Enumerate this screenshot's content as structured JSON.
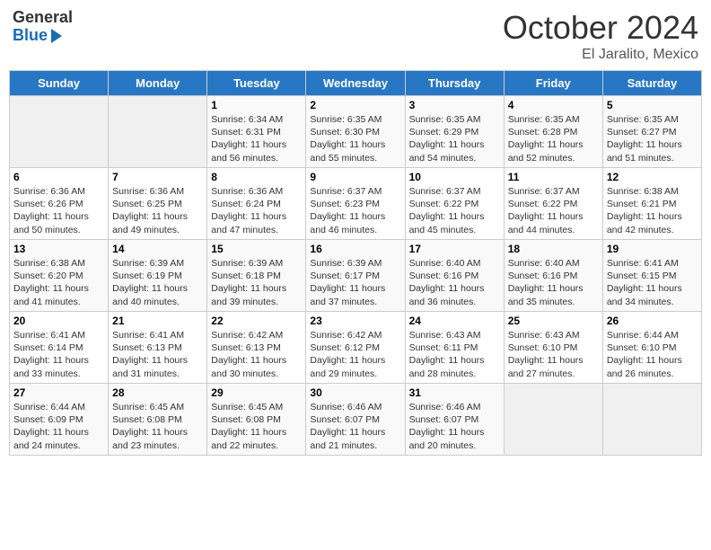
{
  "logo": {
    "general": "General",
    "blue": "Blue"
  },
  "header": {
    "month": "October 2024",
    "location": "El Jaralito, Mexico"
  },
  "days_of_week": [
    "Sunday",
    "Monday",
    "Tuesday",
    "Wednesday",
    "Thursday",
    "Friday",
    "Saturday"
  ],
  "weeks": [
    [
      {
        "day": null
      },
      {
        "day": null
      },
      {
        "day": "1",
        "sunrise": "Sunrise: 6:34 AM",
        "sunset": "Sunset: 6:31 PM",
        "daylight": "Daylight: 11 hours and 56 minutes."
      },
      {
        "day": "2",
        "sunrise": "Sunrise: 6:35 AM",
        "sunset": "Sunset: 6:30 PM",
        "daylight": "Daylight: 11 hours and 55 minutes."
      },
      {
        "day": "3",
        "sunrise": "Sunrise: 6:35 AM",
        "sunset": "Sunset: 6:29 PM",
        "daylight": "Daylight: 11 hours and 54 minutes."
      },
      {
        "day": "4",
        "sunrise": "Sunrise: 6:35 AM",
        "sunset": "Sunset: 6:28 PM",
        "daylight": "Daylight: 11 hours and 52 minutes."
      },
      {
        "day": "5",
        "sunrise": "Sunrise: 6:35 AM",
        "sunset": "Sunset: 6:27 PM",
        "daylight": "Daylight: 11 hours and 51 minutes."
      }
    ],
    [
      {
        "day": "6",
        "sunrise": "Sunrise: 6:36 AM",
        "sunset": "Sunset: 6:26 PM",
        "daylight": "Daylight: 11 hours and 50 minutes."
      },
      {
        "day": "7",
        "sunrise": "Sunrise: 6:36 AM",
        "sunset": "Sunset: 6:25 PM",
        "daylight": "Daylight: 11 hours and 49 minutes."
      },
      {
        "day": "8",
        "sunrise": "Sunrise: 6:36 AM",
        "sunset": "Sunset: 6:24 PM",
        "daylight": "Daylight: 11 hours and 47 minutes."
      },
      {
        "day": "9",
        "sunrise": "Sunrise: 6:37 AM",
        "sunset": "Sunset: 6:23 PM",
        "daylight": "Daylight: 11 hours and 46 minutes."
      },
      {
        "day": "10",
        "sunrise": "Sunrise: 6:37 AM",
        "sunset": "Sunset: 6:22 PM",
        "daylight": "Daylight: 11 hours and 45 minutes."
      },
      {
        "day": "11",
        "sunrise": "Sunrise: 6:37 AM",
        "sunset": "Sunset: 6:22 PM",
        "daylight": "Daylight: 11 hours and 44 minutes."
      },
      {
        "day": "12",
        "sunrise": "Sunrise: 6:38 AM",
        "sunset": "Sunset: 6:21 PM",
        "daylight": "Daylight: 11 hours and 42 minutes."
      }
    ],
    [
      {
        "day": "13",
        "sunrise": "Sunrise: 6:38 AM",
        "sunset": "Sunset: 6:20 PM",
        "daylight": "Daylight: 11 hours and 41 minutes."
      },
      {
        "day": "14",
        "sunrise": "Sunrise: 6:39 AM",
        "sunset": "Sunset: 6:19 PM",
        "daylight": "Daylight: 11 hours and 40 minutes."
      },
      {
        "day": "15",
        "sunrise": "Sunrise: 6:39 AM",
        "sunset": "Sunset: 6:18 PM",
        "daylight": "Daylight: 11 hours and 39 minutes."
      },
      {
        "day": "16",
        "sunrise": "Sunrise: 6:39 AM",
        "sunset": "Sunset: 6:17 PM",
        "daylight": "Daylight: 11 hours and 37 minutes."
      },
      {
        "day": "17",
        "sunrise": "Sunrise: 6:40 AM",
        "sunset": "Sunset: 6:16 PM",
        "daylight": "Daylight: 11 hours and 36 minutes."
      },
      {
        "day": "18",
        "sunrise": "Sunrise: 6:40 AM",
        "sunset": "Sunset: 6:16 PM",
        "daylight": "Daylight: 11 hours and 35 minutes."
      },
      {
        "day": "19",
        "sunrise": "Sunrise: 6:41 AM",
        "sunset": "Sunset: 6:15 PM",
        "daylight": "Daylight: 11 hours and 34 minutes."
      }
    ],
    [
      {
        "day": "20",
        "sunrise": "Sunrise: 6:41 AM",
        "sunset": "Sunset: 6:14 PM",
        "daylight": "Daylight: 11 hours and 33 minutes."
      },
      {
        "day": "21",
        "sunrise": "Sunrise: 6:41 AM",
        "sunset": "Sunset: 6:13 PM",
        "daylight": "Daylight: 11 hours and 31 minutes."
      },
      {
        "day": "22",
        "sunrise": "Sunrise: 6:42 AM",
        "sunset": "Sunset: 6:13 PM",
        "daylight": "Daylight: 11 hours and 30 minutes."
      },
      {
        "day": "23",
        "sunrise": "Sunrise: 6:42 AM",
        "sunset": "Sunset: 6:12 PM",
        "daylight": "Daylight: 11 hours and 29 minutes."
      },
      {
        "day": "24",
        "sunrise": "Sunrise: 6:43 AM",
        "sunset": "Sunset: 6:11 PM",
        "daylight": "Daylight: 11 hours and 28 minutes."
      },
      {
        "day": "25",
        "sunrise": "Sunrise: 6:43 AM",
        "sunset": "Sunset: 6:10 PM",
        "daylight": "Daylight: 11 hours and 27 minutes."
      },
      {
        "day": "26",
        "sunrise": "Sunrise: 6:44 AM",
        "sunset": "Sunset: 6:10 PM",
        "daylight": "Daylight: 11 hours and 26 minutes."
      }
    ],
    [
      {
        "day": "27",
        "sunrise": "Sunrise: 6:44 AM",
        "sunset": "Sunset: 6:09 PM",
        "daylight": "Daylight: 11 hours and 24 minutes."
      },
      {
        "day": "28",
        "sunrise": "Sunrise: 6:45 AM",
        "sunset": "Sunset: 6:08 PM",
        "daylight": "Daylight: 11 hours and 23 minutes."
      },
      {
        "day": "29",
        "sunrise": "Sunrise: 6:45 AM",
        "sunset": "Sunset: 6:08 PM",
        "daylight": "Daylight: 11 hours and 22 minutes."
      },
      {
        "day": "30",
        "sunrise": "Sunrise: 6:46 AM",
        "sunset": "Sunset: 6:07 PM",
        "daylight": "Daylight: 11 hours and 21 minutes."
      },
      {
        "day": "31",
        "sunrise": "Sunrise: 6:46 AM",
        "sunset": "Sunset: 6:07 PM",
        "daylight": "Daylight: 11 hours and 20 minutes."
      },
      {
        "day": null
      },
      {
        "day": null
      }
    ]
  ]
}
